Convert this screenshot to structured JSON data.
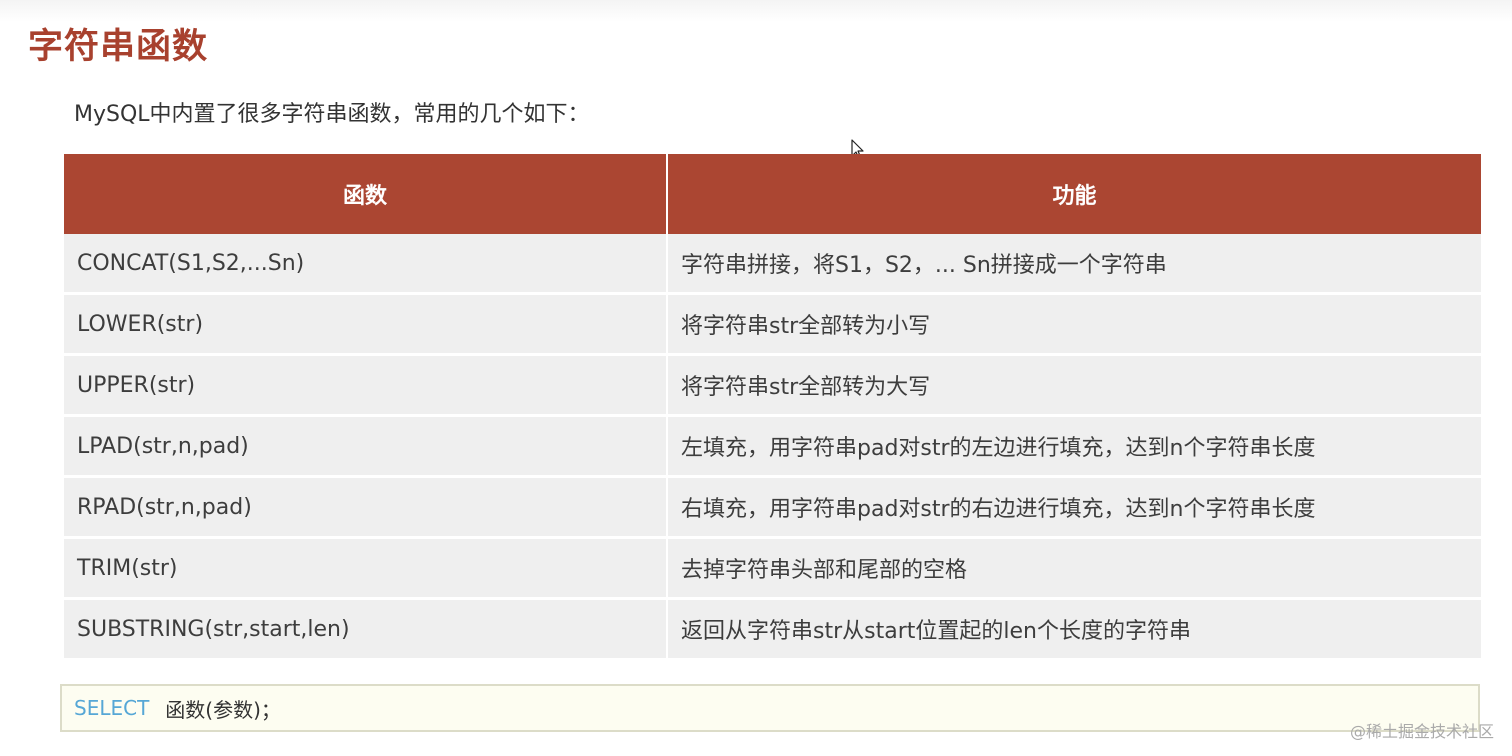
{
  "slide": {
    "title": "字符串函数",
    "intro": "MySQL中内置了很多字符串函数，常用的几个如下："
  },
  "table": {
    "headers": [
      "函数",
      "功能"
    ],
    "rows": [
      {
        "func": "CONCAT(S1,S2,...Sn)",
        "desc": "字符串拼接，将S1，S2，... Sn拼接成一个字符串"
      },
      {
        "func": "LOWER(str)",
        "desc": "将字符串str全部转为小写"
      },
      {
        "func": "UPPER(str)",
        "desc": "将字符串str全部转为大写"
      },
      {
        "func": "LPAD(str,n,pad)",
        "desc": "左填充，用字符串pad对str的左边进行填充，达到n个字符串长度"
      },
      {
        "func": "RPAD(str,n,pad)",
        "desc": "右填充，用字符串pad对str的右边进行填充，达到n个字符串长度"
      },
      {
        "func": "TRIM(str)",
        "desc": "去掉字符串头部和尾部的空格"
      },
      {
        "func": "SUBSTRING(str,start,len)",
        "desc": "返回从字符串str从start位置起的len个长度的字符串"
      }
    ]
  },
  "code": {
    "keyword": "SELECT",
    "rest": "函数(参数)；"
  },
  "watermark": "@稀土掘金技术社区",
  "colors": {
    "title": "#a8412e",
    "header_bg": "#ab4632",
    "row_bg": "#efefef",
    "keyword": "#56a7d6",
    "code_bg": "#fdfdf1"
  },
  "icons": {
    "cursor": "mouse-pointer-icon"
  }
}
